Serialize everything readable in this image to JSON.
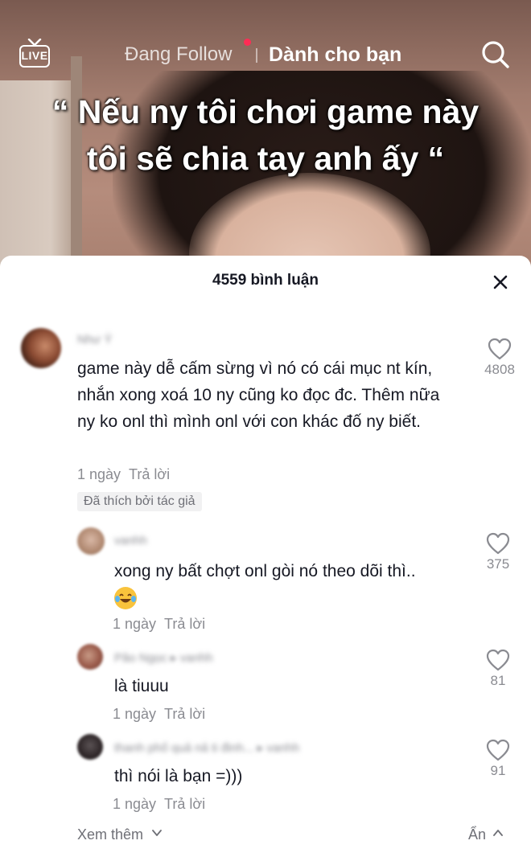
{
  "header": {
    "live_label": "LIVE",
    "following_tab": "Đang Follow",
    "for_you_tab": "Dành cho bạn"
  },
  "video": {
    "caption_line1": "“ Nếu ny tôi chơi game này",
    "caption_line2": "tôi sẽ chia tay anh ấy “"
  },
  "comments_sheet": {
    "title": "4559 bình luận",
    "comments": [
      {
        "username": "Như Ý",
        "text": "game này dễ cấm sừng vì nó có cái mục nt kín, nhắn xong xoá 10 ny cũng ko đọc đc. Thêm nữa ny ko onl thì mình onl với con khác đố ny biết.",
        "time": "1 ngày",
        "reply_label": "Trả lời",
        "liked_by_author": "Đã thích bởi tác giả",
        "likes": "4808"
      }
    ],
    "replies": [
      {
        "username": "vanhh",
        "text": "xong ny bất chợt onl gòi nó theo dõi thì..",
        "emoji": "tears-of-joy",
        "time": "1 ngày",
        "reply_label": "Trả lời",
        "likes": "375"
      },
      {
        "username": "Pâo Ngọc ▸ vanhh",
        "text": "là tiuuu",
        "time": "1 ngày",
        "reply_label": "Trả lời",
        "likes": "81"
      },
      {
        "username": "thanh phố quả nả ti đinh... ▸ vanhh",
        "text": "thì nói là bạn =)))",
        "time": "1 ngày",
        "reply_label": "Trả lời",
        "likes": "91"
      }
    ],
    "view_more": "Xem thêm",
    "hide": "Ẩn"
  },
  "colors": {
    "accent_red": "#fe2c55",
    "text_primary": "#161823",
    "text_secondary": "#8a8b91"
  }
}
